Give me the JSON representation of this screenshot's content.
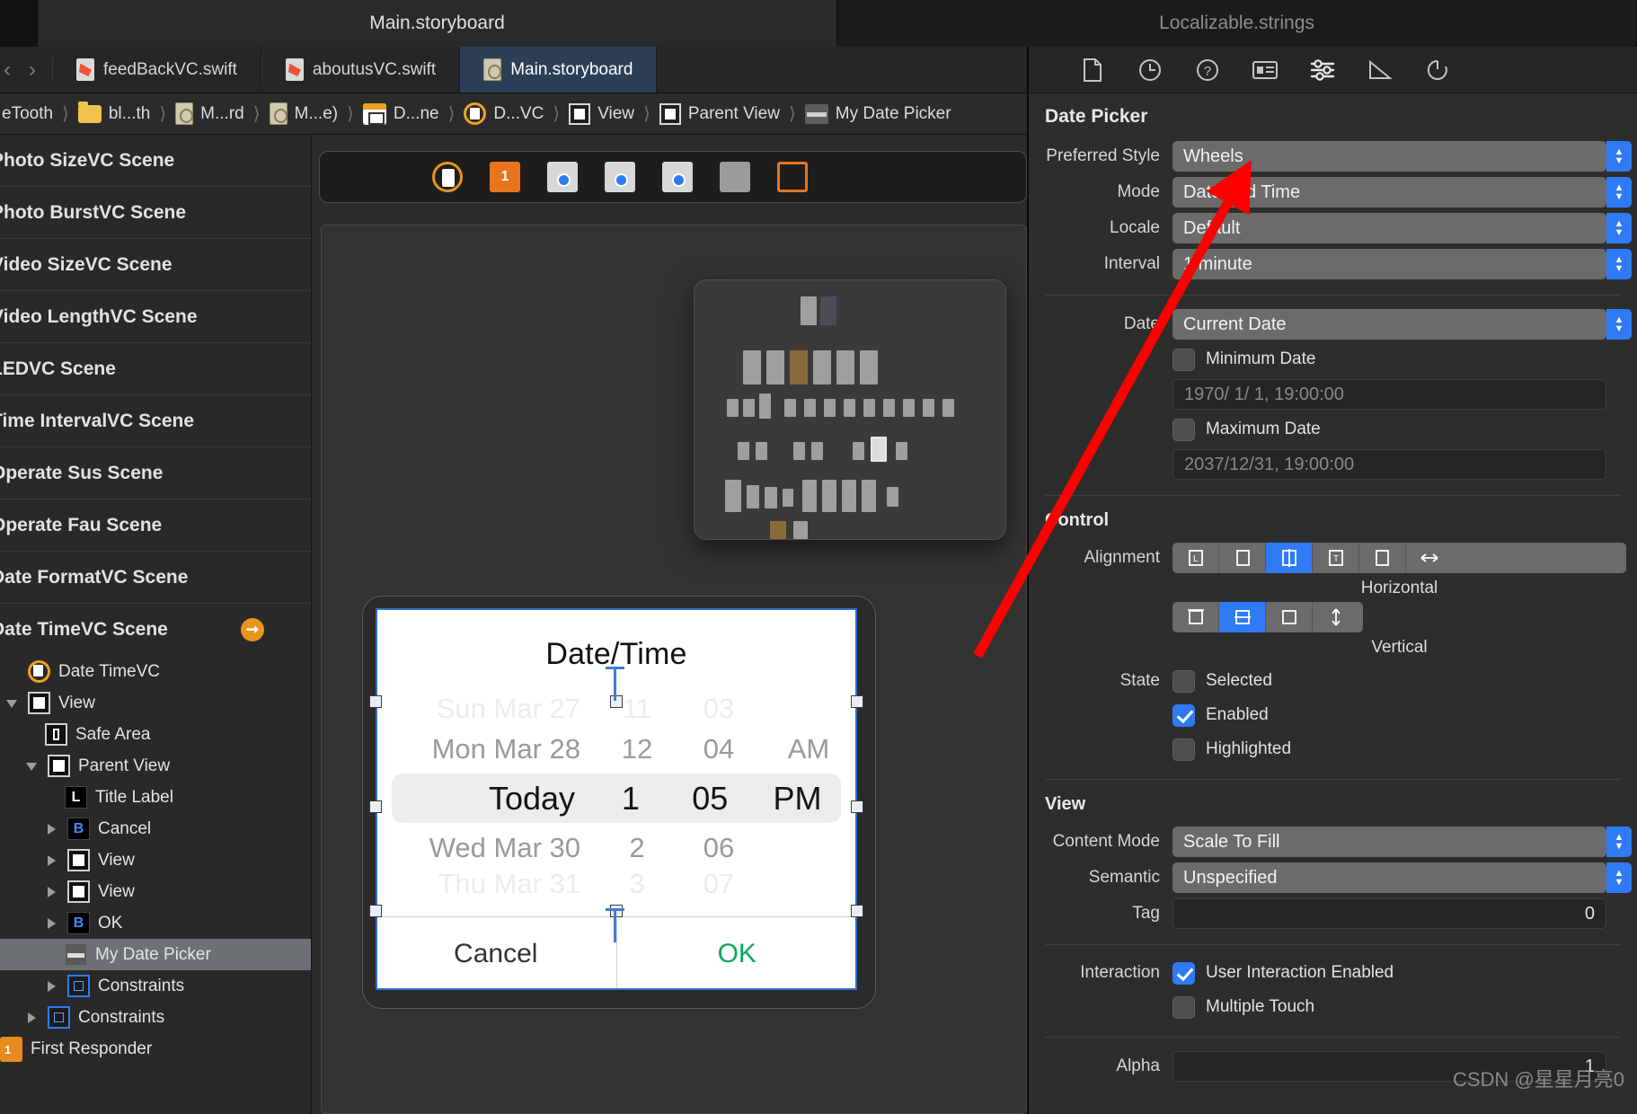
{
  "window": {
    "tabs": [
      {
        "label": "Main.storyboard",
        "active": true
      },
      {
        "label": "Localizable.strings",
        "active": false
      }
    ]
  },
  "file_tabs": [
    {
      "label": "feedBackVC.swift",
      "icon": "swift-file-icon",
      "active": false
    },
    {
      "label": "aboutusVC.swift",
      "icon": "swift-file-icon",
      "active": false
    },
    {
      "label": "Main.storyboard",
      "icon": "storyboard-file-icon",
      "active": true
    }
  ],
  "tabbar_right_icons": [
    "editor-lines-icon",
    "add-editor-icon"
  ],
  "breadcrumb": {
    "items": [
      {
        "label": "eTooth",
        "icon": "project-icon"
      },
      {
        "label": "bl...th",
        "icon": "folder-icon"
      },
      {
        "label": "M...rd",
        "icon": "storyboard-file-icon"
      },
      {
        "label": "M...e)",
        "icon": "storyboard-file-icon"
      },
      {
        "label": "D...ne",
        "icon": "scene-icon"
      },
      {
        "label": "D...VC",
        "icon": "view-controller-icon"
      },
      {
        "label": "View",
        "icon": "view-icon"
      },
      {
        "label": "Parent View",
        "icon": "view-icon"
      },
      {
        "label": "My Date Picker",
        "icon": "date-picker-icon"
      }
    ],
    "prev_label": "‹",
    "next_label": "›",
    "warning_badge": "warning-triangle-icon"
  },
  "navigator": {
    "scenes": [
      "Photo SizeVC Scene",
      "Photo BurstVC Scene",
      "Video SizeVC Scene",
      "Video LengthVC Scene",
      "LEDVC Scene",
      "Time IntervalVC Scene",
      "Operate Sus Scene",
      "Operate Fau Scene",
      "Date FormatVC Scene",
      "Date TimeVC Scene"
    ],
    "tree": [
      {
        "label": "Date TimeVC",
        "icon": "view-controller-icon",
        "indent": 0,
        "disclosure": "none",
        "selected": false
      },
      {
        "label": "View",
        "icon": "view-icon",
        "indent": 0,
        "disclosure": "down",
        "selected": false
      },
      {
        "label": "Safe Area",
        "icon": "safe-area-icon",
        "indent": 1,
        "disclosure": "none",
        "selected": false
      },
      {
        "label": "Parent View",
        "icon": "view-icon",
        "indent": 1,
        "disclosure": "down",
        "selected": false
      },
      {
        "label": "Title Label",
        "icon": "label-icon",
        "indent": 2,
        "disclosure": "none",
        "selected": false
      },
      {
        "label": "Cancel",
        "icon": "button-icon",
        "indent": 2,
        "disclosure": "right",
        "selected": false
      },
      {
        "label": "View",
        "icon": "view-icon",
        "indent": 2,
        "disclosure": "right",
        "selected": false
      },
      {
        "label": "View",
        "icon": "view-icon",
        "indent": 2,
        "disclosure": "right",
        "selected": false
      },
      {
        "label": "OK",
        "icon": "button-icon",
        "indent": 2,
        "disclosure": "right",
        "selected": false
      },
      {
        "label": "My Date Picker",
        "icon": "date-picker-icon",
        "indent": 2,
        "disclosure": "none",
        "selected": true
      },
      {
        "label": "Constraints",
        "icon": "constraints-icon",
        "indent": 2,
        "disclosure": "right",
        "selected": false
      },
      {
        "label": "Constraints",
        "icon": "constraints-icon",
        "indent": 1,
        "disclosure": "right",
        "selected": false
      },
      {
        "label": "First Responder",
        "icon": "first-responder-icon",
        "indent": 0,
        "disclosure": "none",
        "selected": false
      }
    ]
  },
  "canvas": {
    "toolbar_icons": [
      "device-icon",
      "cube-icon",
      "view-controller-icon",
      "view-controller-icon",
      "view-controller-icon",
      "segue-icon",
      "exit-icon"
    ],
    "modal": {
      "title": "Date/Time",
      "wheels": {
        "columns": [
          "date",
          "hour",
          "minute",
          "meridiem"
        ],
        "rows": [
          {
            "date": "Sun Mar 27",
            "hour": "11",
            "minute": "03",
            "meridiem": "",
            "state": "faded-top"
          },
          {
            "date": "Mon Mar 28",
            "hour": "12",
            "minute": "04",
            "meridiem": "AM",
            "state": "normal"
          },
          {
            "date": "Today",
            "hour": "1",
            "minute": "05",
            "meridiem": "PM",
            "state": "selected"
          },
          {
            "date": "Wed Mar 30",
            "hour": "2",
            "minute": "06",
            "meridiem": "",
            "state": "normal"
          },
          {
            "date": "Thu Mar 31",
            "hour": "3",
            "minute": "07",
            "meridiem": "",
            "state": "faded-bottom"
          }
        ]
      },
      "cancel_label": "Cancel",
      "ok_label": "OK",
      "ok_color": "#0aa85a"
    }
  },
  "inspector": {
    "toolbar_icons": [
      "file-inspector-icon",
      "history-inspector-icon",
      "help-inspector-icon",
      "identity-inspector-icon",
      "attributes-inspector-icon",
      "size-inspector-icon",
      "connections-inspector-icon"
    ],
    "title": "Date Picker",
    "date_picker": {
      "fields": [
        {
          "label": "Preferred Style",
          "value": "Wheels"
        },
        {
          "label": "Mode",
          "value": "Date and Time"
        },
        {
          "label": "Locale",
          "value": "Default"
        },
        {
          "label": "Interval",
          "value": "1 minute"
        }
      ],
      "date_field": {
        "label": "Date",
        "value": "Current Date"
      },
      "minimum": {
        "label": "Minimum Date",
        "checked": false,
        "value": "1970/  1/  1, 19:00:00"
      },
      "maximum": {
        "label": "Maximum Date",
        "checked": false,
        "value": "2037/12/31, 19:00:00"
      }
    },
    "control": {
      "section": "Control",
      "alignment_label": "Alignment",
      "horizontal_caption": "Horizontal",
      "vertical_caption": "Vertical",
      "horizontal_segments": [
        "align-left-icon",
        "align-leading-icon",
        "align-center-icon",
        "align-trailing-icon",
        "align-right-icon",
        "align-fill-icon"
      ],
      "horizontal_selected_index": 2,
      "vertical_segments": [
        "align-top-icon",
        "align-middle-icon",
        "align-bottom-icon",
        "align-fill-vertical-icon"
      ],
      "vertical_selected_index": 1,
      "state_label": "State",
      "states": [
        {
          "label": "Selected",
          "checked": false
        },
        {
          "label": "Enabled",
          "checked": true
        },
        {
          "label": "Highlighted",
          "checked": false
        }
      ]
    },
    "view": {
      "section": "View",
      "content_mode": {
        "label": "Content Mode",
        "value": "Scale To Fill"
      },
      "semantic": {
        "label": "Semantic",
        "value": "Unspecified"
      },
      "tag": {
        "label": "Tag",
        "value": "0"
      },
      "interaction_label": "Interaction",
      "interaction": [
        {
          "label": "User Interaction Enabled",
          "checked": true
        },
        {
          "label": "Multiple Touch",
          "checked": false
        }
      ],
      "alpha": {
        "label": "Alpha",
        "value": "1"
      }
    },
    "accent_color": "#2f7bf5"
  },
  "annotation": {
    "arrow_color": "#ff0000"
  },
  "watermark": "CSDN @星星月亮0"
}
